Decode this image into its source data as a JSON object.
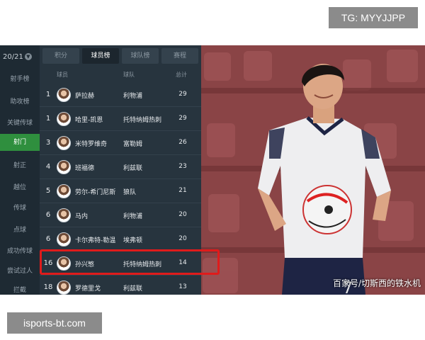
{
  "overlay": {
    "tg_label": "TG: MYYJJPP",
    "watermark": "isports-bt.com"
  },
  "season": {
    "label": "20/21"
  },
  "nav": [
    {
      "label": "射手榜"
    },
    {
      "label": "助攻榜"
    },
    {
      "label": "关键传球"
    },
    {
      "label": "射门"
    },
    {
      "label": "射正"
    },
    {
      "label": "越位"
    },
    {
      "label": "传球"
    },
    {
      "label": "点球"
    },
    {
      "label": "成功传球"
    },
    {
      "label": "尝试过人"
    },
    {
      "label": "拦截"
    }
  ],
  "nav_active": "射门",
  "tabs": [
    {
      "label": "积分"
    },
    {
      "label": "球员榜"
    },
    {
      "label": "球队榜"
    },
    {
      "label": "赛程"
    }
  ],
  "active_tab": "球员榜",
  "table": {
    "headers": {
      "player": "球员",
      "team": "球队",
      "total": "总计"
    },
    "rows": [
      {
        "rank": "1",
        "name": "萨拉赫",
        "team": "利物浦",
        "total": "29"
      },
      {
        "rank": "1",
        "name": "哈里-凯恩",
        "team": "托特纳姆热刺",
        "total": "29"
      },
      {
        "rank": "3",
        "name": "米特罗维奇",
        "team": "富勒姆",
        "total": "26"
      },
      {
        "rank": "4",
        "name": "班福德",
        "team": "利兹联",
        "total": "23"
      },
      {
        "rank": "5",
        "name": "劳尔-希门尼斯",
        "team": "狼队",
        "total": "21"
      },
      {
        "rank": "6",
        "name": "马内",
        "team": "利物浦",
        "total": "20"
      },
      {
        "rank": "6",
        "name": "卡尔弗特-勒温",
        "team": "埃弗顿",
        "total": "20"
      },
      {
        "rank": "16",
        "name": "孙兴慜",
        "team": "托特纳姆热刺",
        "total": "14"
      },
      {
        "rank": "18",
        "name": "罗德里戈",
        "team": "利兹联",
        "total": "13"
      }
    ]
  },
  "photo": {
    "caption": "百家号/切斯西的铁水机",
    "shirt_number": "7"
  },
  "colors": {
    "accent_green": "#2f8f3e",
    "highlight_red": "#e01b1b",
    "panel_bg": "#27343e"
  }
}
